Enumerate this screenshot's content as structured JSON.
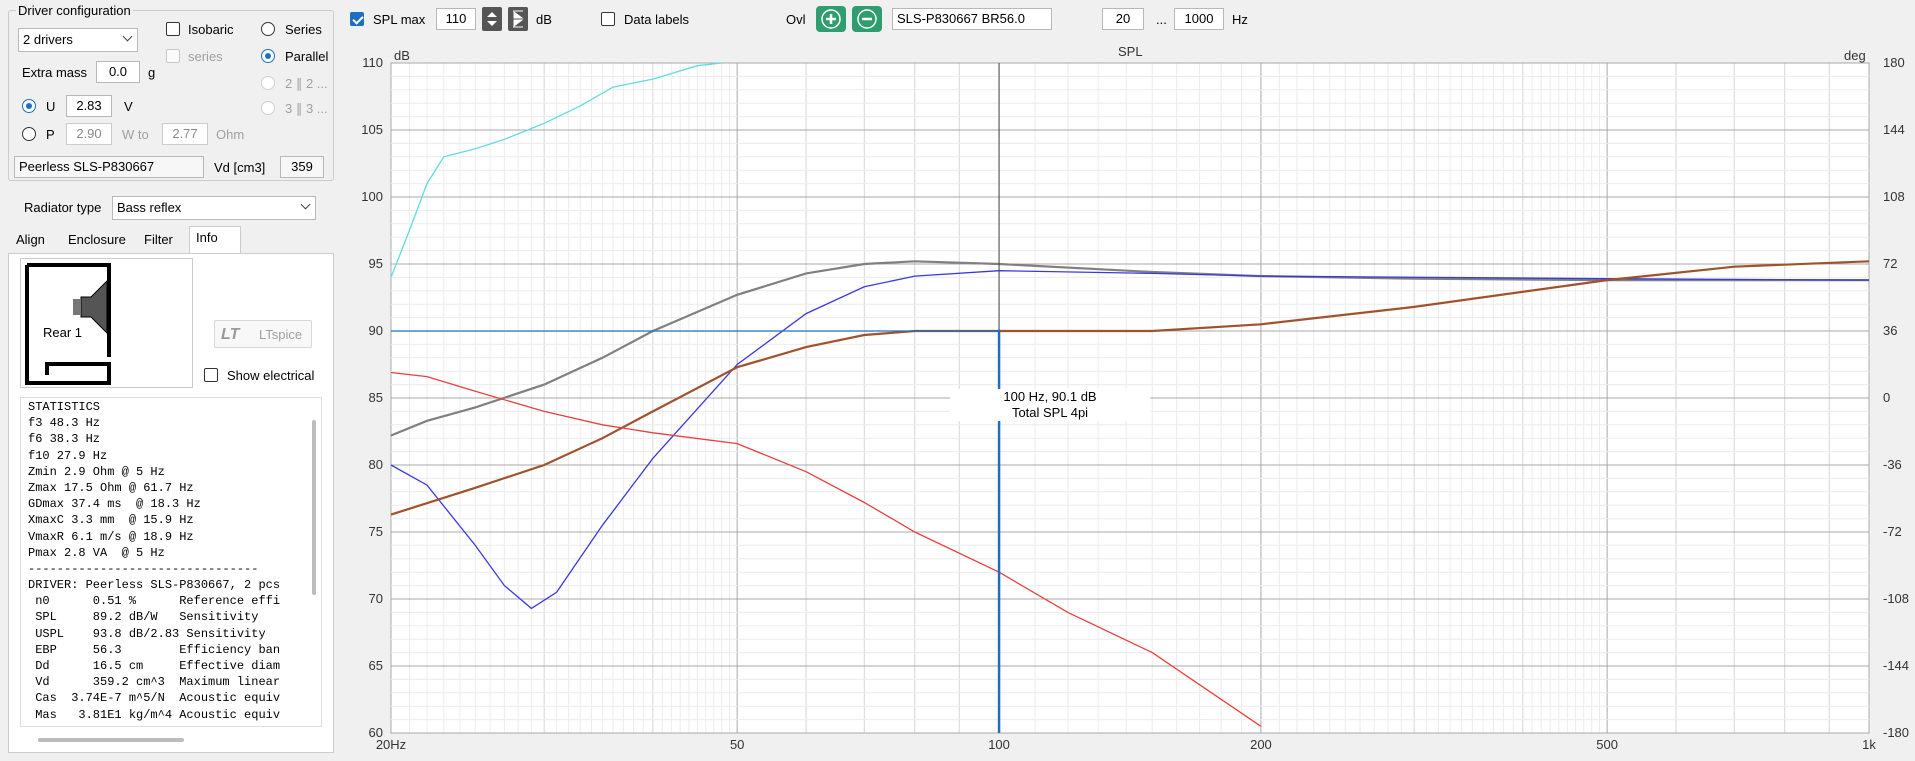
{
  "driver_config": {
    "group_title": "Driver configuration",
    "drivers_select": "2 drivers",
    "isobaric_label": "Isobaric",
    "series_checkbox_label": "series",
    "series_radio_label": "Series",
    "parallel_radio_label": "Parallel",
    "option_2x2_label": "2 ∥ 2 ...",
    "option_3x3_label": "3 ∥ 3 ...",
    "extra_mass_label": "Extra mass",
    "extra_mass_value": "0.0",
    "extra_mass_unit": "g",
    "u_label": "U",
    "u_value": "2.83",
    "u_unit": "V",
    "p_label": "P",
    "p_value": "2.90",
    "w_to_label": "W to",
    "ohm_value": "2.77",
    "ohm_label": "Ohm",
    "driver_name": "Peerless SLS-P830667",
    "vd_label": "Vd [cm3]",
    "vd_value": "359"
  },
  "radiator": {
    "label": "Radiator type",
    "value": "Bass reflex"
  },
  "tabs": [
    {
      "label": "Align"
    },
    {
      "label": "Enclosure"
    },
    {
      "label": "Filter"
    },
    {
      "label": "Info"
    }
  ],
  "info": {
    "diagram_label": "Rear 1",
    "ltspice_label": "LTspice",
    "show_electrical_label": "Show electrical"
  },
  "statistics": [
    "STATISTICS",
    "f3 48.3 Hz",
    "f6 38.3 Hz",
    "f10 27.9 Hz",
    "Zmin 2.9 Ohm @ 5 Hz",
    "Zmax 17.5 Ohm @ 61.7 Hz",
    "GDmax 37.4 ms  @ 18.3 Hz",
    "XmaxC 3.3 mm  @ 15.9 Hz",
    "VmaxR 6.1 m/s @ 18.9 Hz",
    "Pmax 2.8 VA  @ 5 Hz",
    "--------------------------------",
    "DRIVER: Peerless SLS-P830667, 2 pcs",
    " n0      0.51 %      Reference effi",
    " SPL     89.2 dB/W   Sensitivity",
    " USPL    93.8 dB/2.83 Sensitivity",
    " EBP     56.3        Efficiency ban",
    " Dd      16.5 cm     Effective diam",
    " Vd      359.2 cm^3  Maximum linear",
    " Cas  3.74E-7 m^5/N  Acoustic equiv",
    " Mas   3.81E1 kg/m^4 Acoustic equiv"
  ],
  "toolbar": {
    "spl_max_label": "SPL max",
    "spl_max_value": "110",
    "db_label": "dB",
    "data_labels_label": "Data labels",
    "ovl_label": "Ovl",
    "overlay_name": "SLS-P830667 BR56.0",
    "freq_min": "20",
    "ellipsis": "...",
    "freq_max": "1000",
    "hz_label": "Hz"
  },
  "colors": {
    "accent": "#1f6fbf",
    "grid": "#d6d6d6",
    "grid_major": "#a8a8a8"
  },
  "chart_data": {
    "type": "line",
    "title": "SPL",
    "ylabel": "dB",
    "y2label": "deg",
    "x_scale": "log",
    "xlim": [
      20,
      1000
    ],
    "ylim": [
      60,
      110
    ],
    "y2lim": [
      -180,
      180
    ],
    "x_tick_labels": [
      {
        "value": 20,
        "label": "20Hz"
      },
      {
        "value": 50,
        "label": "50"
      },
      {
        "value": 100,
        "label": "100"
      },
      {
        "value": 200,
        "label": "200"
      },
      {
        "value": 500,
        "label": "500"
      },
      {
        "value": 1000,
        "label": "1k"
      }
    ],
    "y_ticks": [
      60,
      65,
      70,
      75,
      80,
      85,
      90,
      95,
      100,
      105,
      110
    ],
    "y2_ticks": [
      -180,
      -144,
      -108,
      -72,
      -36,
      0,
      36,
      72,
      108,
      144,
      180
    ],
    "grid": true,
    "cursor": {
      "x": 100,
      "y": 90.1,
      "label1": "100 Hz, 90.1 dB",
      "label2": "Total SPL 4pi"
    },
    "series": [
      {
        "color": "#808080",
        "points": [
          [
            20,
            82.2
          ],
          [
            22,
            83.3
          ],
          [
            25,
            84.3
          ],
          [
            30,
            86
          ],
          [
            35,
            88
          ],
          [
            40,
            90
          ],
          [
            50,
            92.7
          ],
          [
            60,
            94.3
          ],
          [
            70,
            95
          ],
          [
            80,
            95.2
          ],
          [
            100,
            95
          ],
          [
            150,
            94.4
          ],
          [
            200,
            94.1
          ],
          [
            300,
            93.9
          ],
          [
            500,
            93.8
          ],
          [
            1000,
            93.8
          ]
        ]
      },
      {
        "color": "#3a3adc",
        "points": [
          [
            20,
            80
          ],
          [
            22,
            78.5
          ],
          [
            25,
            74
          ],
          [
            27,
            71
          ],
          [
            29,
            69.3
          ],
          [
            31,
            70.5
          ],
          [
            35,
            75.5
          ],
          [
            40,
            80.5
          ],
          [
            50,
            87.5
          ],
          [
            60,
            91.3
          ],
          [
            70,
            93.3
          ],
          [
            80,
            94.1
          ],
          [
            100,
            94.5
          ],
          [
            150,
            94.3
          ],
          [
            200,
            94.1
          ],
          [
            500,
            93.9
          ],
          [
            1000,
            93.8
          ]
        ]
      },
      {
        "color": "#a0522d",
        "points": [
          [
            20,
            76.3
          ],
          [
            25,
            78.3
          ],
          [
            30,
            80
          ],
          [
            35,
            82
          ],
          [
            40,
            84
          ],
          [
            50,
            87.3
          ],
          [
            60,
            88.8
          ],
          [
            70,
            89.7
          ],
          [
            80,
            90
          ],
          [
            100,
            90
          ],
          [
            150,
            90
          ],
          [
            200,
            90.5
          ],
          [
            300,
            91.8
          ],
          [
            500,
            93.8
          ],
          [
            700,
            94.8
          ],
          [
            1000,
            95.2
          ]
        ]
      },
      {
        "color": "#e84040",
        "points": [
          [
            20,
            86.9
          ],
          [
            22,
            86.6
          ],
          [
            25,
            85.5
          ],
          [
            30,
            84
          ],
          [
            35,
            83
          ],
          [
            40,
            82.4
          ],
          [
            50,
            81.6
          ],
          [
            60,
            79.5
          ],
          [
            70,
            77.2
          ],
          [
            80,
            75
          ],
          [
            100,
            72
          ],
          [
            120,
            69
          ],
          [
            150,
            66
          ],
          [
            200,
            60.5
          ]
        ]
      },
      {
        "color": "#5fdcdc",
        "points": [
          [
            20,
            94
          ],
          [
            21,
            97.5
          ],
          [
            22,
            101
          ],
          [
            23,
            103
          ],
          [
            25,
            103.6
          ],
          [
            27,
            104.3
          ],
          [
            30,
            105.5
          ],
          [
            33,
            106.8
          ],
          [
            36,
            108.2
          ],
          [
            40,
            108.8
          ],
          [
            45,
            109.8
          ],
          [
            48,
            110
          ]
        ]
      },
      {
        "color": "#1f6fbf",
        "points": [
          [
            20,
            90
          ],
          [
            100,
            90
          ]
        ]
      }
    ]
  }
}
